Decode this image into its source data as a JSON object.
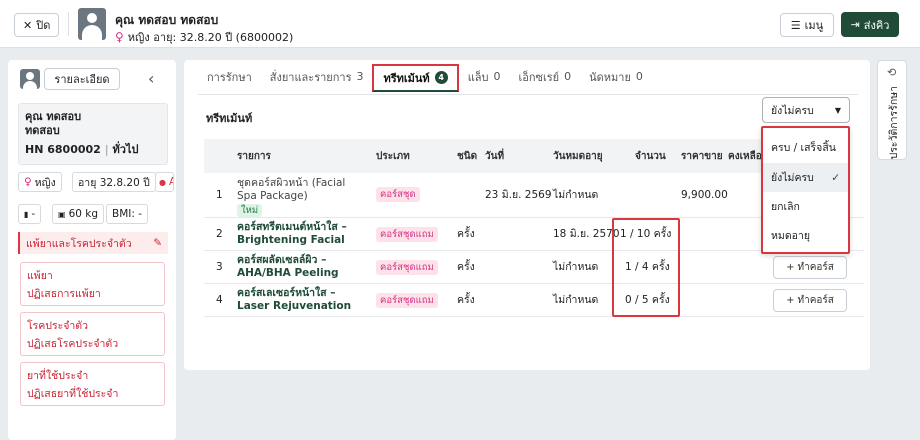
{
  "topbar": {
    "close_label": "ปิด",
    "patient_name": "คุณ ทดสอบ ทดสอบ",
    "patient_sub": "หญิง  อายุ: 32.8.20 ปี  (6800002)",
    "menu_label": "เมนู",
    "send_label": "ส่งคิว"
  },
  "left": {
    "detail_button": "รายละเอียด",
    "name_line1": "คุณ ทดสอบ",
    "name_line2": "ทดสอบ",
    "hn": "HN 6800002",
    "hn_type": "ทั่วไป",
    "gender": "หญิง",
    "age": "อายุ 32.8.20 ปี",
    "blood": "A",
    "height": "-",
    "weight": "60 kg",
    "bmi": "BMI: -",
    "alert_title": "แพ้ยาและโรคประจำตัว",
    "allergy_title": "แพ้ยา",
    "allergy_value": "ปฏิเสธการแพ้ยา",
    "disease_title": "โรคประจำตัว",
    "disease_value": "ปฏิเสธโรคประจำตัว",
    "meds_title": "ยาที่ใช้ประจำ",
    "meds_value": "ปฏิเสธยาที่ใช้ประจำ"
  },
  "tabs": [
    {
      "label": "การรักษา",
      "count": ""
    },
    {
      "label": "สั่งยาและรายการ",
      "count": "3"
    },
    {
      "label": "ทรีทเม้นท์",
      "count": "4"
    },
    {
      "label": "แล็บ",
      "count": "0"
    },
    {
      "label": "เอ็กซเรย์",
      "count": "0"
    },
    {
      "label": "นัดหมาย",
      "count": "0"
    }
  ],
  "section": {
    "title": "ทรีทเม้นท์",
    "filter_value": "ยังไม่ครบ"
  },
  "table": {
    "headers": [
      "รายการ",
      "ประเภท",
      "ชนิด",
      "วันที่",
      "วันหมดอายุ",
      "จำนวน",
      "ราคาขาย",
      "คงเหลือ"
    ],
    "rows": [
      {
        "no": "1",
        "name": "ชุดคอร์สผิวหน้า (Facial Spa Package)",
        "new": "ใหม่",
        "type": "คอร์สชุด",
        "kind": "",
        "date": "23 มิ.ย. 2569",
        "expiry": "ไม่กำหนด",
        "qty": "",
        "price": "9,900.00",
        "action": ""
      },
      {
        "no": "2",
        "name": "คอร์สทรีตเมนต์หน้าใส – Brightening Facial",
        "new": "",
        "type": "คอร์สชุดแถม",
        "kind": "ครั้ง",
        "date": "",
        "expiry": "18 มิ.ย. 2570",
        "qty": "1 / 10 ครั้ง",
        "price": "",
        "action": ""
      },
      {
        "no": "3",
        "name": "คอร์สผลัดเซลล์ผิว – AHA/BHA Peeling",
        "new": "",
        "type": "คอร์สชุดแถม",
        "kind": "ครั้ง",
        "date": "",
        "expiry": "ไม่กำหนด",
        "qty": "1 / 4 ครั้ง",
        "price": "",
        "action": "ทำคอร์ส"
      },
      {
        "no": "4",
        "name": "คอร์สเลเซอร์หน้าใส – Laser Rejuvenation",
        "new": "",
        "type": "คอร์สชุดแถม",
        "kind": "ครั้ง",
        "date": "",
        "expiry": "ไม่กำหนด",
        "qty": "0 / 5 ครั้ง",
        "price": "",
        "action": "ทำคอร์ส"
      }
    ]
  },
  "dropdown": {
    "options": [
      "ครบ / เสร็จสิ้น",
      "ยังไม่ครบ",
      "ยกเลิก",
      "หมดอายุ"
    ],
    "selected": "ยังไม่ครบ"
  },
  "right_sidebar": {
    "label": "ประวัติการรักษา"
  },
  "colors": {
    "primary": "#1f4b37",
    "highlight": "#d9363e",
    "tag_pink": "#d63384"
  }
}
